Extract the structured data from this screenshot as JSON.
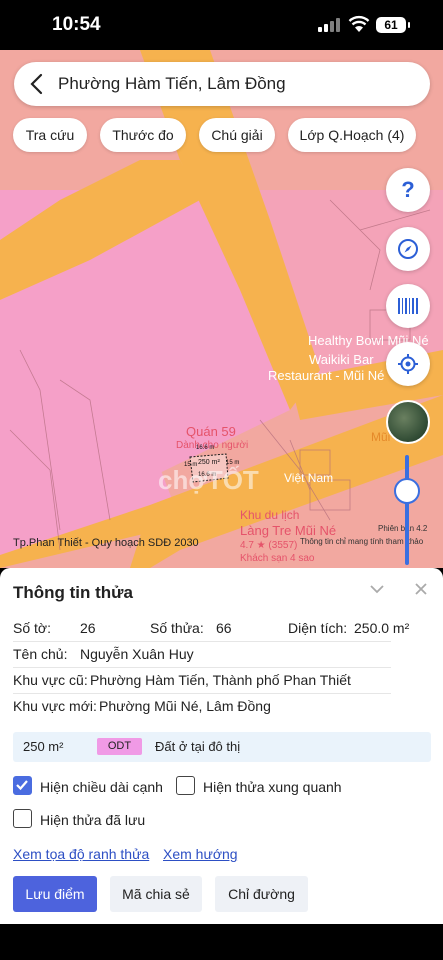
{
  "status": {
    "time": "10:54",
    "battery": "61"
  },
  "search": {
    "title": "Phường Hàm Tiến, Lâm Đồng"
  },
  "chips": [
    "Tra cứu",
    "Thước đo",
    "Chú giải",
    "Lớp Q.Hoạch (4)"
  ],
  "fabs": {
    "help": "?"
  },
  "map": {
    "poi_healthy": "Healthy Bowl Mũi Né",
    "poi_waikiki": "Waikiki Bar",
    "poi_restaurant": "Restaurant - Mũi Né",
    "poi_quan59": "Quán 59",
    "poi_quan59_sub": "Dành cho người",
    "poi_viet_nam": "Việt Nam",
    "poi_cof": "Mũi Cof",
    "poi_khu_du_lich": "Khu du lịch",
    "poi_lang_tre": "Làng Tre Mũi Né",
    "poi_rating": "4.7 ★ (3557)",
    "poi_hotel": "Khách sạn 4 sao",
    "parcel_area": "250 m²",
    "edge_top": "16.6 m",
    "edge_bottom": "16.6 m",
    "edge_left": "15 m",
    "edge_right": "15 m",
    "watermark": "chợTỐT",
    "plan_label": "Tp.Phan Thiết - Quy hoạch SDĐ 2030",
    "version": "Phiên bản 4.2",
    "disclaimer": "Thông tin chỉ mang tính tham khảo"
  },
  "sheet": {
    "title": "Thông tin thửa",
    "so_to_label": "Số tờ:",
    "so_to": "26",
    "so_thua_label": "Số thửa:",
    "so_thua": "66",
    "dien_tich_label": "Diện tích:",
    "dien_tich": "250.0 m²",
    "ten_chu_label": "Tên chủ:",
    "ten_chu": "Nguyễn Xuân Huy",
    "khu_vuc_cu_label": "Khu vực cũ:",
    "khu_vuc_cu": "Phường Hàm Tiến, Thành phố Phan Thiết",
    "khu_vuc_moi_label": "Khu vực mới:",
    "khu_vuc_moi": "Phường Mũi Né, Lâm Đồng",
    "area_value": "250 m²",
    "land_code": "ODT",
    "land_type": "Đất ở tại đô thị",
    "check_edge_length": "Hiện chiều dài cạnh",
    "check_neighbors": "Hiện thửa xung quanh",
    "check_saved": "Hiện thửa đã lưu",
    "link_coords": "Xem tọa độ ranh thửa",
    "link_direction": "Xem hướng",
    "btn_save": "Lưu điểm",
    "btn_share": "Mã chia sẻ",
    "btn_route": "Chỉ đường"
  },
  "colors": {
    "accent": "#4d63dd",
    "map_pink": "#f5a0c8",
    "map_orange": "#f6b24e",
    "map_salmon": "#f2a8a0"
  }
}
